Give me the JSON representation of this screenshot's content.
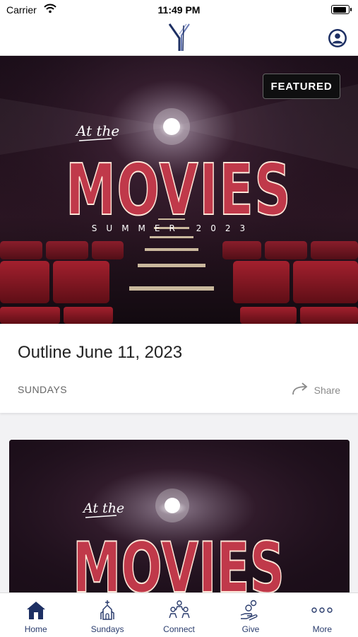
{
  "status_bar": {
    "carrier": "Carrier",
    "time": "11:49 PM"
  },
  "header": {
    "logo_icon": "church-logo-icon",
    "profile_icon": "user-profile-icon"
  },
  "featured_card": {
    "badge": "FEATURED",
    "image": {
      "script_text": "At the",
      "main_text": "MOVIES",
      "sub_text": "SUMMER 2023"
    },
    "title": "Outline June 11, 2023",
    "category": "SUNDAYS",
    "share_label": "Share"
  },
  "second_card": {
    "image": {
      "script_text": "At the",
      "main_text": "MOVIES"
    }
  },
  "tab_bar": {
    "tabs": [
      {
        "label": "Home",
        "icon": "home-icon",
        "active": true
      },
      {
        "label": "Sundays",
        "icon": "church-icon",
        "active": false
      },
      {
        "label": "Connect",
        "icon": "people-icon",
        "active": false
      },
      {
        "label": "Give",
        "icon": "give-icon",
        "active": false
      },
      {
        "label": "More",
        "icon": "more-dots-icon",
        "active": false
      }
    ]
  },
  "colors": {
    "brand_navy": "#1d2f63",
    "marquee_red": "#c0394a",
    "background": "#f2f2f4"
  }
}
